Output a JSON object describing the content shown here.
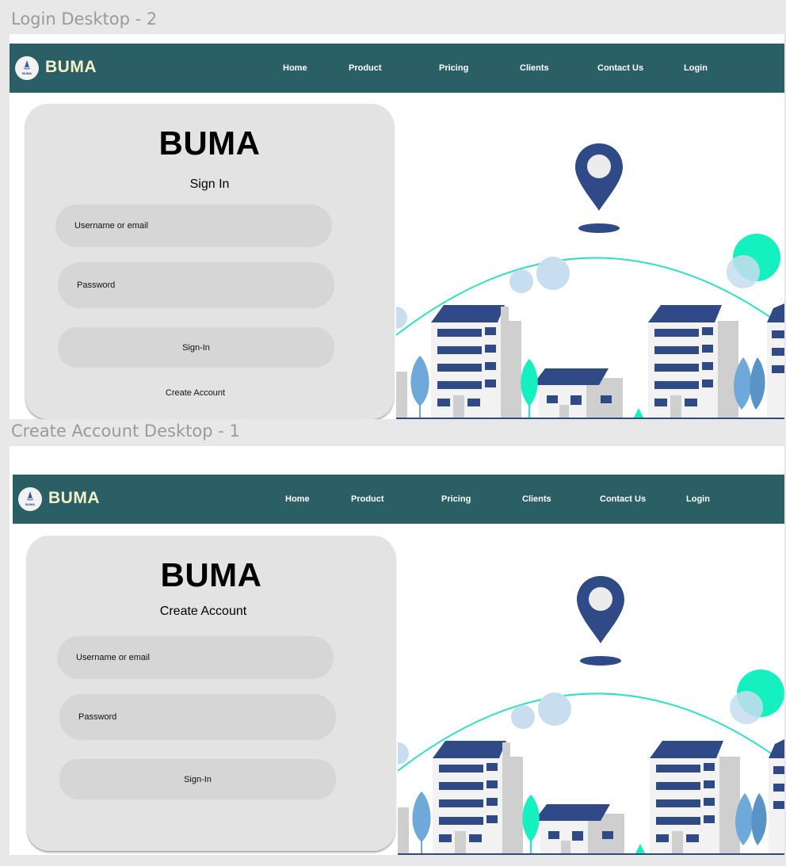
{
  "frames": [
    {
      "label": "Login Desktop - 2",
      "nav": {
        "brand": "BUMA",
        "logo_small_text": "BUMA",
        "items": [
          "Home",
          "Product",
          "Pricing",
          "Clients",
          "Contact Us",
          "Login"
        ]
      },
      "card": {
        "title": "BUMA",
        "subtitle": "Sign In",
        "username_placeholder": "Username or email",
        "password_placeholder": "Password",
        "submit_label": "Sign-In",
        "link_label": "Create Account"
      }
    },
    {
      "label": "Create Account Desktop - 1",
      "nav": {
        "brand": "BUMA",
        "logo_small_text": "BUMA",
        "items": [
          "Home",
          "Product",
          "Pricing",
          "Clients",
          "Contact Us",
          "Login"
        ]
      },
      "card": {
        "title": "BUMA",
        "subtitle": "Create Account",
        "username_placeholder": "Username or email",
        "password_placeholder": "Password",
        "submit_label": "Sign-In"
      }
    }
  ],
  "colors": {
    "navbar": "#2b5f66",
    "brand_text": "#f4f1c6",
    "card": "#e3e3e3",
    "field": "#d6d6d6",
    "pin": "#2f4a86",
    "arc": "#2fe0c4",
    "accent_green": "#14f0c0"
  },
  "icons": {
    "logo": "buma-logo-icon",
    "pin": "location-pin-icon"
  }
}
